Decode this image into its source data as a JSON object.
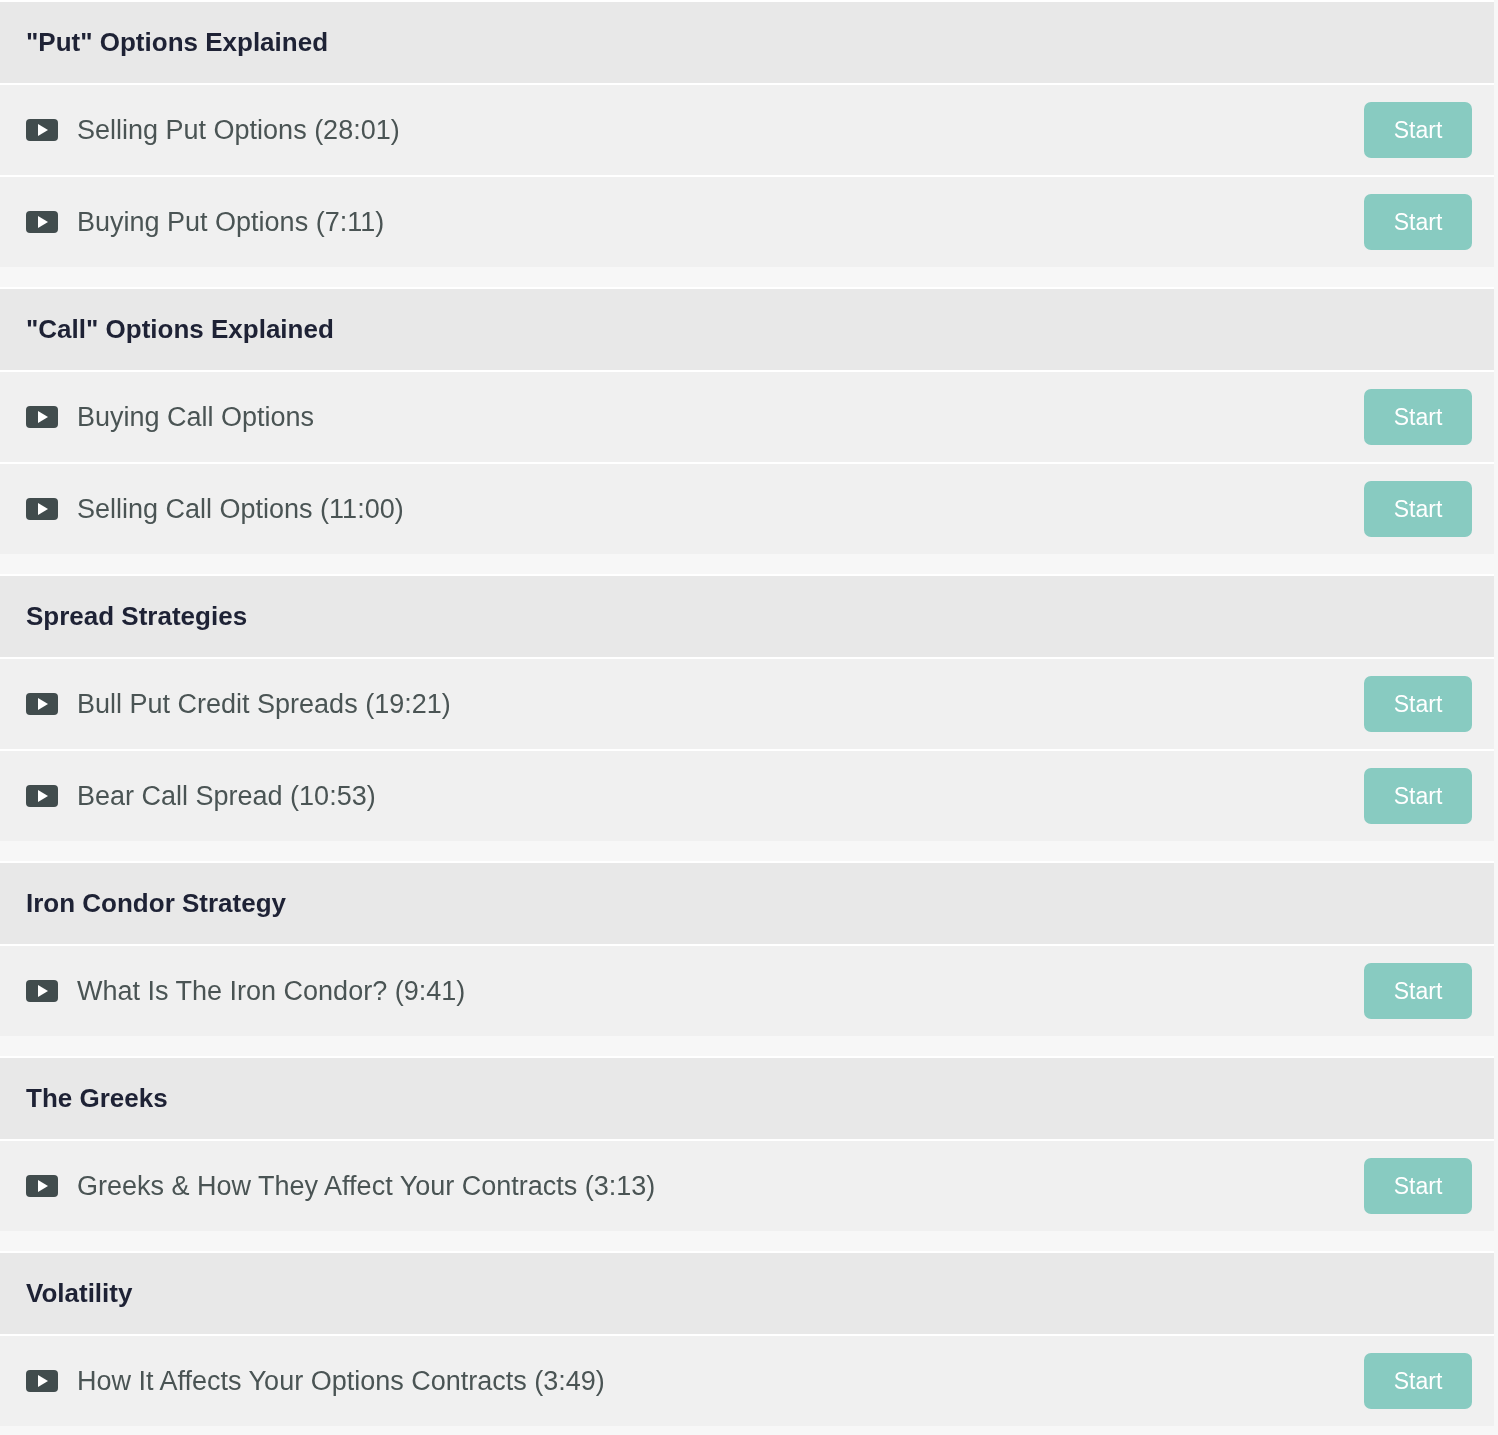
{
  "sections": [
    {
      "title": "\"Put\" Options Explained",
      "lessons": [
        {
          "title": "Selling Put Options (28:01)",
          "button": "Start"
        },
        {
          "title": "Buying Put Options (7:11)",
          "button": "Start"
        }
      ]
    },
    {
      "title": "\"Call\" Options Explained",
      "lessons": [
        {
          "title": "Buying Call Options",
          "button": "Start"
        },
        {
          "title": "Selling Call Options (11:00)",
          "button": "Start"
        }
      ]
    },
    {
      "title": "Spread Strategies",
      "lessons": [
        {
          "title": "Bull Put Credit Spreads (19:21)",
          "button": "Start"
        },
        {
          "title": "Bear Call Spread (10:53)",
          "button": "Start"
        }
      ]
    },
    {
      "title": "Iron Condor Strategy",
      "lessons": [
        {
          "title": "What Is The Iron Condor? (9:41)",
          "button": "Start"
        }
      ]
    },
    {
      "title": "The Greeks",
      "lessons": [
        {
          "title": "Greeks & How They Affect Your Contracts (3:13)",
          "button": "Start"
        }
      ]
    },
    {
      "title": "Volatility",
      "lessons": [
        {
          "title": "How It Affects Your Options Contracts (3:49)",
          "button": "Start"
        }
      ]
    }
  ]
}
